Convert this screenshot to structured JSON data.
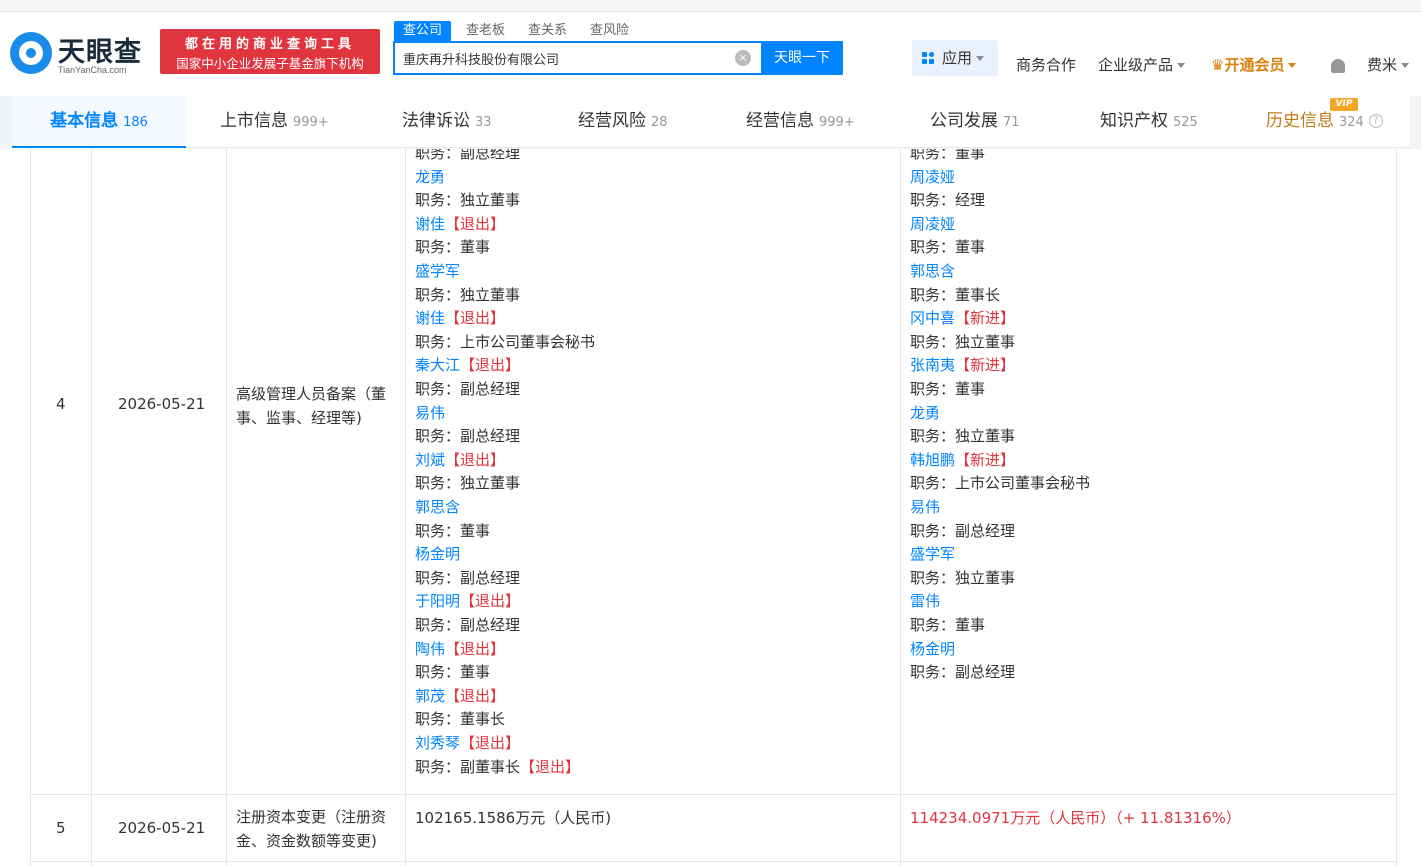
{
  "header": {
    "logo_name": "天眼查",
    "logo_sub": "TianYanCha.com",
    "slogan_line1": "都在用的商业查询工具",
    "slogan_line2": "国家中小企业发展子基金旗下机构",
    "search_tabs": [
      "查公司",
      "查老板",
      "查关系",
      "查风险"
    ],
    "search_value": "重庆再升科技股份有限公司",
    "search_button": "天眼一下",
    "nav": {
      "app": "应用",
      "biz": "商务合作",
      "enterprise": "企业级产品",
      "vip": "开通会员",
      "user": "费米"
    }
  },
  "tabs": [
    {
      "label": "基本信息",
      "count": "186"
    },
    {
      "label": "上市信息",
      "count": "999+"
    },
    {
      "label": "法律诉讼",
      "count": "33"
    },
    {
      "label": "经营风险",
      "count": "28"
    },
    {
      "label": "经营信息",
      "count": "999+"
    },
    {
      "label": "公司发展",
      "count": "71"
    },
    {
      "label": "知识产权",
      "count": "525"
    },
    {
      "label": "历史信息",
      "count": "324"
    }
  ],
  "vip_badge": "VIP",
  "rows": [
    {
      "index": "4",
      "date": "2026-05-21",
      "item_line1": "高级管理人员备案（董",
      "item_line2": "事、监事、经理等)",
      "before": [
        {
          "text": "职务：副总经理"
        },
        {
          "name": "龙勇"
        },
        {
          "text": "职务：独立董事"
        },
        {
          "name": "谢佳",
          "tag": "【退出】"
        },
        {
          "text": "职务：董事"
        },
        {
          "name": "盛学军"
        },
        {
          "text": "职务：独立董事"
        },
        {
          "name": "谢佳",
          "tag": "【退出】"
        },
        {
          "text": "职务：上市公司董事会秘书"
        },
        {
          "name": "秦大江",
          "tag": "【退出】"
        },
        {
          "text": "职务：副总经理"
        },
        {
          "name": "易伟"
        },
        {
          "text": "职务：副总经理"
        },
        {
          "name": "刘斌",
          "tag": "【退出】"
        },
        {
          "text": "职务：独立董事"
        },
        {
          "name": "郭思含"
        },
        {
          "text": "职务：董事"
        },
        {
          "name": "杨金明"
        },
        {
          "text": "职务：副总经理"
        },
        {
          "name": "于阳明",
          "tag": "【退出】"
        },
        {
          "text": "职务：副总经理"
        },
        {
          "name": "陶伟",
          "tag": "【退出】"
        },
        {
          "text": "职务：董事"
        },
        {
          "name": "郭茂",
          "tag": "【退出】"
        },
        {
          "text": "职务：董事长"
        },
        {
          "name": "刘秀琴",
          "tag": "【退出】"
        },
        {
          "text": "职务：副董事长",
          "tag": "【退出】"
        }
      ],
      "after": [
        {
          "text": "职务：董事"
        },
        {
          "name": "周凌娅"
        },
        {
          "text": "职务：经理"
        },
        {
          "name": "周凌娅"
        },
        {
          "text": "职务：董事"
        },
        {
          "name": "郭思含"
        },
        {
          "text": "职务：董事长"
        },
        {
          "name": "冈中喜",
          "tag": "【新进】"
        },
        {
          "text": "职务：独立董事"
        },
        {
          "name": "张南夷",
          "tag": "【新进】"
        },
        {
          "text": "职务：董事"
        },
        {
          "name": "龙勇"
        },
        {
          "text": "职务：独立董事"
        },
        {
          "name": "韩旭鹏",
          "tag": "【新进】"
        },
        {
          "text": "职务：上市公司董事会秘书"
        },
        {
          "name": "易伟"
        },
        {
          "text": "职务：副总经理"
        },
        {
          "name": "盛学军"
        },
        {
          "text": "职务：独立董事"
        },
        {
          "name": "雷伟"
        },
        {
          "text": "职务：董事"
        },
        {
          "name": "杨金明"
        },
        {
          "text": "职务：副总经理"
        }
      ]
    },
    {
      "index": "5",
      "date": "2026-05-21",
      "item_line1": "注册资本变更（注册资",
      "item_line2": "金、资金数额等变更)",
      "before_text": "102165.1586万元（人民币)",
      "after_text": "114234.0971万元（人民币）（+ 11.81316%）"
    }
  ]
}
